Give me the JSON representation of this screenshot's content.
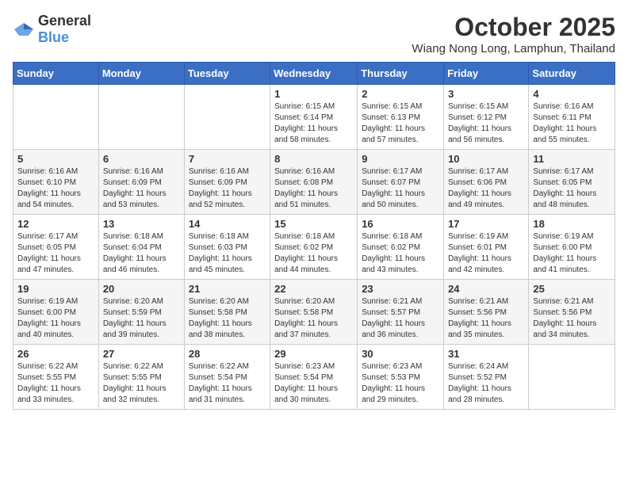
{
  "logo": {
    "general": "General",
    "blue": "Blue"
  },
  "header": {
    "month_year": "October 2025",
    "location": "Wiang Nong Long, Lamphun, Thailand"
  },
  "weekdays": [
    "Sunday",
    "Monday",
    "Tuesday",
    "Wednesday",
    "Thursday",
    "Friday",
    "Saturday"
  ],
  "weeks": [
    [
      {
        "day": "",
        "content": ""
      },
      {
        "day": "",
        "content": ""
      },
      {
        "day": "",
        "content": ""
      },
      {
        "day": "1",
        "content": "Sunrise: 6:15 AM\nSunset: 6:14 PM\nDaylight: 11 hours and 58 minutes."
      },
      {
        "day": "2",
        "content": "Sunrise: 6:15 AM\nSunset: 6:13 PM\nDaylight: 11 hours and 57 minutes."
      },
      {
        "day": "3",
        "content": "Sunrise: 6:15 AM\nSunset: 6:12 PM\nDaylight: 11 hours and 56 minutes."
      },
      {
        "day": "4",
        "content": "Sunrise: 6:16 AM\nSunset: 6:11 PM\nDaylight: 11 hours and 55 minutes."
      }
    ],
    [
      {
        "day": "5",
        "content": "Sunrise: 6:16 AM\nSunset: 6:10 PM\nDaylight: 11 hours and 54 minutes."
      },
      {
        "day": "6",
        "content": "Sunrise: 6:16 AM\nSunset: 6:09 PM\nDaylight: 11 hours and 53 minutes."
      },
      {
        "day": "7",
        "content": "Sunrise: 6:16 AM\nSunset: 6:09 PM\nDaylight: 11 hours and 52 minutes."
      },
      {
        "day": "8",
        "content": "Sunrise: 6:16 AM\nSunset: 6:08 PM\nDaylight: 11 hours and 51 minutes."
      },
      {
        "day": "9",
        "content": "Sunrise: 6:17 AM\nSunset: 6:07 PM\nDaylight: 11 hours and 50 minutes."
      },
      {
        "day": "10",
        "content": "Sunrise: 6:17 AM\nSunset: 6:06 PM\nDaylight: 11 hours and 49 minutes."
      },
      {
        "day": "11",
        "content": "Sunrise: 6:17 AM\nSunset: 6:05 PM\nDaylight: 11 hours and 48 minutes."
      }
    ],
    [
      {
        "day": "12",
        "content": "Sunrise: 6:17 AM\nSunset: 6:05 PM\nDaylight: 11 hours and 47 minutes."
      },
      {
        "day": "13",
        "content": "Sunrise: 6:18 AM\nSunset: 6:04 PM\nDaylight: 11 hours and 46 minutes."
      },
      {
        "day": "14",
        "content": "Sunrise: 6:18 AM\nSunset: 6:03 PM\nDaylight: 11 hours and 45 minutes."
      },
      {
        "day": "15",
        "content": "Sunrise: 6:18 AM\nSunset: 6:02 PM\nDaylight: 11 hours and 44 minutes."
      },
      {
        "day": "16",
        "content": "Sunrise: 6:18 AM\nSunset: 6:02 PM\nDaylight: 11 hours and 43 minutes."
      },
      {
        "day": "17",
        "content": "Sunrise: 6:19 AM\nSunset: 6:01 PM\nDaylight: 11 hours and 42 minutes."
      },
      {
        "day": "18",
        "content": "Sunrise: 6:19 AM\nSunset: 6:00 PM\nDaylight: 11 hours and 41 minutes."
      }
    ],
    [
      {
        "day": "19",
        "content": "Sunrise: 6:19 AM\nSunset: 6:00 PM\nDaylight: 11 hours and 40 minutes."
      },
      {
        "day": "20",
        "content": "Sunrise: 6:20 AM\nSunset: 5:59 PM\nDaylight: 11 hours and 39 minutes."
      },
      {
        "day": "21",
        "content": "Sunrise: 6:20 AM\nSunset: 5:58 PM\nDaylight: 11 hours and 38 minutes."
      },
      {
        "day": "22",
        "content": "Sunrise: 6:20 AM\nSunset: 5:58 PM\nDaylight: 11 hours and 37 minutes."
      },
      {
        "day": "23",
        "content": "Sunrise: 6:21 AM\nSunset: 5:57 PM\nDaylight: 11 hours and 36 minutes."
      },
      {
        "day": "24",
        "content": "Sunrise: 6:21 AM\nSunset: 5:56 PM\nDaylight: 11 hours and 35 minutes."
      },
      {
        "day": "25",
        "content": "Sunrise: 6:21 AM\nSunset: 5:56 PM\nDaylight: 11 hours and 34 minutes."
      }
    ],
    [
      {
        "day": "26",
        "content": "Sunrise: 6:22 AM\nSunset: 5:55 PM\nDaylight: 11 hours and 33 minutes."
      },
      {
        "day": "27",
        "content": "Sunrise: 6:22 AM\nSunset: 5:55 PM\nDaylight: 11 hours and 32 minutes."
      },
      {
        "day": "28",
        "content": "Sunrise: 6:22 AM\nSunset: 5:54 PM\nDaylight: 11 hours and 31 minutes."
      },
      {
        "day": "29",
        "content": "Sunrise: 6:23 AM\nSunset: 5:54 PM\nDaylight: 11 hours and 30 minutes."
      },
      {
        "day": "30",
        "content": "Sunrise: 6:23 AM\nSunset: 5:53 PM\nDaylight: 11 hours and 29 minutes."
      },
      {
        "day": "31",
        "content": "Sunrise: 6:24 AM\nSunset: 5:52 PM\nDaylight: 11 hours and 28 minutes."
      },
      {
        "day": "",
        "content": ""
      }
    ]
  ]
}
